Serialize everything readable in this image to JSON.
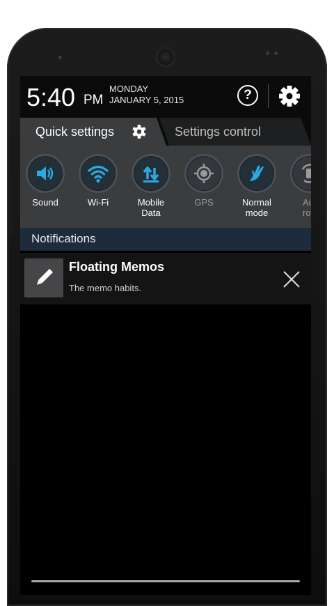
{
  "status": {
    "time": "5:40",
    "ampm": "PM",
    "day": "MONDAY",
    "date": "JANUARY 5, 2015"
  },
  "header": {
    "help_icon_text": "?"
  },
  "tabs": [
    {
      "label": "Quick settings",
      "active": true
    },
    {
      "label": "Settings control",
      "active": false
    }
  ],
  "quick_settings": [
    {
      "label": "Sound",
      "icon": "speaker-icon",
      "state": "on"
    },
    {
      "label": "Wi-Fi",
      "icon": "wifi-icon",
      "state": "on"
    },
    {
      "label": "Mobile\nData",
      "icon": "mobile-data-icon",
      "state": "on"
    },
    {
      "label": "GPS",
      "icon": "gps-icon",
      "state": "off"
    },
    {
      "label": "Normal\nmode",
      "icon": "hand-icon",
      "state": "on"
    },
    {
      "label": "Au\nrota",
      "icon": "auto-rotate-icon",
      "state": "off"
    }
  ],
  "notifications": {
    "section_label": "Notifications",
    "items": [
      {
        "title": "Floating Memos",
        "text": "The memo habits.",
        "icon": "pencil-icon"
      }
    ]
  },
  "colors": {
    "accent": "#2da8e0",
    "panel": "#3a3c3e",
    "notif_bar": "#1d2b3a"
  }
}
